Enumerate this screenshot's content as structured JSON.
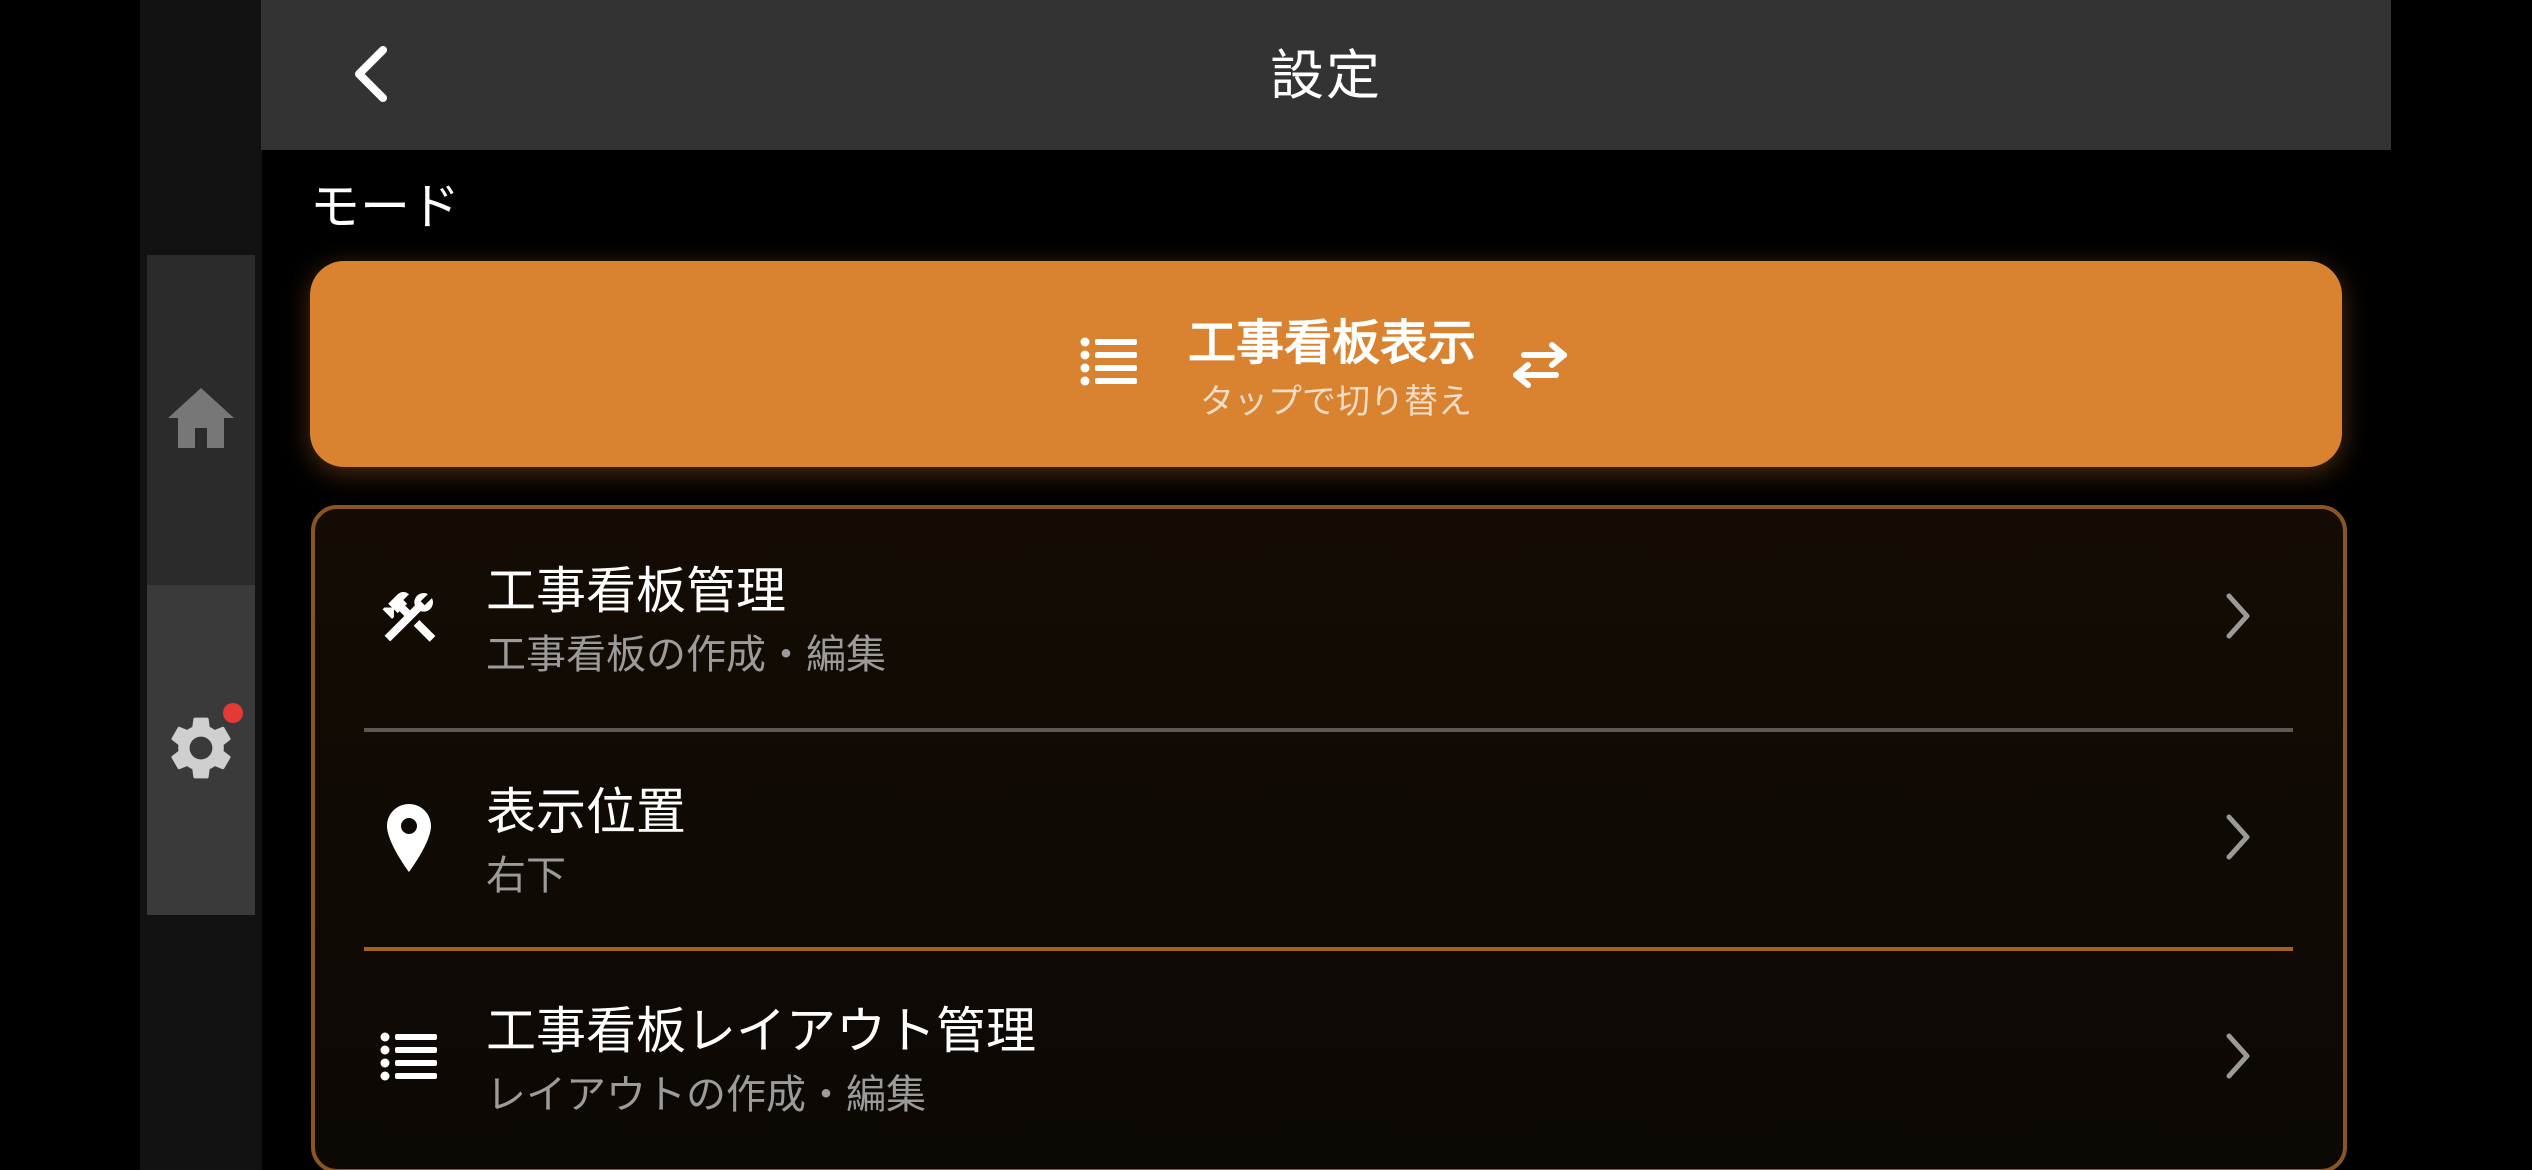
{
  "header": {
    "title": "設定",
    "back_icon": "chevron-left-icon"
  },
  "rail": {
    "items": [
      {
        "name": "home",
        "icon": "home-icon"
      },
      {
        "name": "settings",
        "icon": "gear-icon",
        "badge": true
      }
    ]
  },
  "section": {
    "label": "モード"
  },
  "mode": {
    "title": "工事看板表示",
    "subtitle": "タップで切り替え",
    "icon": "list-icon",
    "swap_icon": "swap-arrows-icon",
    "color": "#d9822f"
  },
  "settings_items": [
    {
      "title": "工事看板管理",
      "subtitle": "工事看板の作成・編集",
      "icon": "tools-icon"
    },
    {
      "title": "表示位置",
      "subtitle": "右下",
      "icon": "location-pin-icon"
    },
    {
      "title": "工事看板レイアウト管理",
      "subtitle": "レイアウトの作成・編集",
      "icon": "list-icon"
    }
  ],
  "colors": {
    "accent": "#d9822f",
    "badge": "#e53935",
    "header_bg": "#333333"
  }
}
